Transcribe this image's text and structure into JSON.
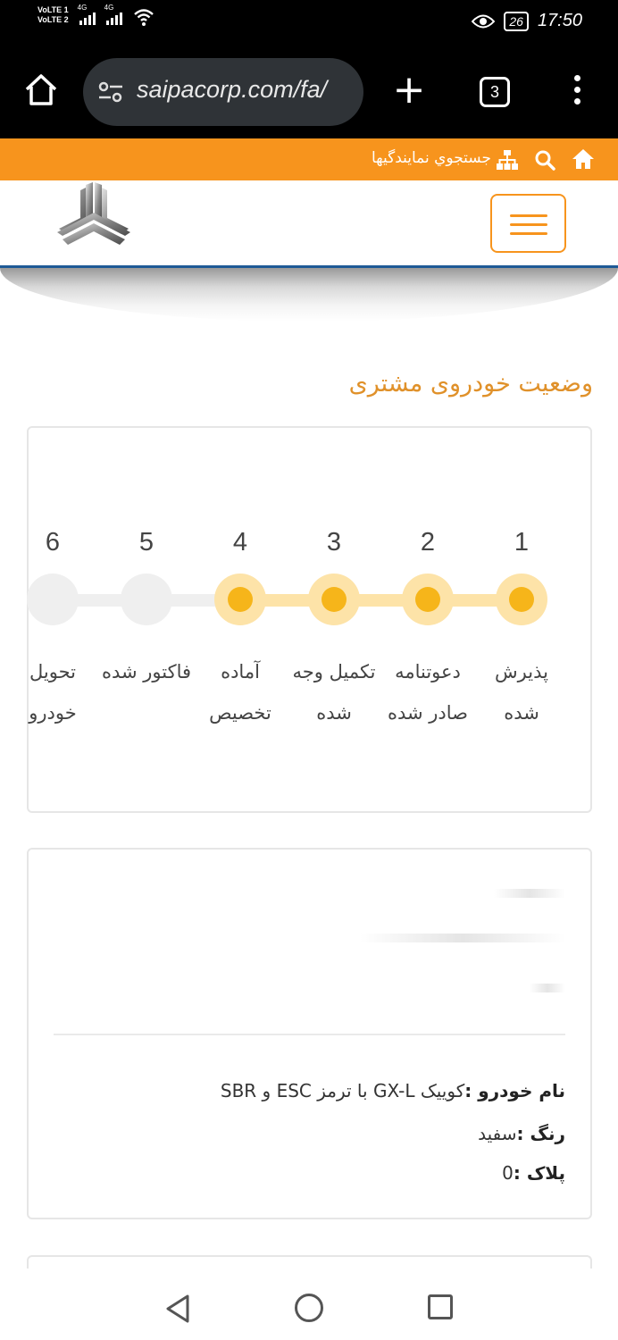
{
  "status_bar": {
    "sim1": "VoLTE 1",
    "sim2": "VoLTE 2",
    "net1": "4G",
    "net2": "4G",
    "battery": "26",
    "time": "17:50"
  },
  "browser": {
    "url": "saipacorp.com/fa/",
    "tab_count": "3"
  },
  "top_bar": {
    "dealer_search": "جستجوي نمايندگيها"
  },
  "page": {
    "title": "وضعیت خودروی مشتری"
  },
  "steps": [
    {
      "number": "1",
      "label": "پذیرش شده",
      "done": true
    },
    {
      "number": "2",
      "label": "دعوتنامه صادر شده",
      "done": true
    },
    {
      "number": "3",
      "label": "تکمیل وجه شده",
      "done": true
    },
    {
      "number": "4",
      "label": "آماده تخصیص",
      "done": true
    },
    {
      "number": "5",
      "label": "فاکتور شده",
      "done": false
    },
    {
      "number": "6",
      "label": "تحویل خودرو",
      "done": false
    }
  ],
  "vehicle": {
    "name_label": "نام خودرو :",
    "name_value": "کوییک GX-L با ترمز ESC و SBR",
    "color_label": "رنگ :",
    "color_value": "سفید",
    "plate_label": "پلاک :",
    "plate_value": "0"
  },
  "colors": {
    "accent": "#f7941d",
    "title": "#e0912a",
    "step_done": "#f6b51a",
    "step_done_ring": "#fde3a8",
    "step_todo": "#efefef",
    "header_border": "#1e5a96"
  }
}
